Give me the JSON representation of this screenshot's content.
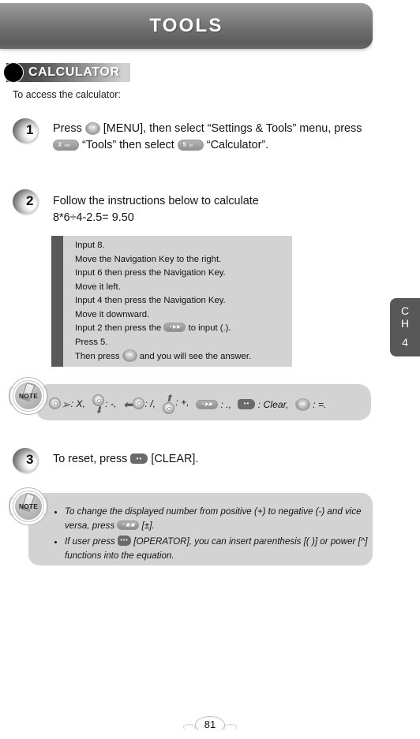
{
  "header": {
    "title": "TOOLS"
  },
  "section": {
    "title": "CALCULATOR",
    "intro": "To access the calculator:"
  },
  "steps": [
    {
      "number": "1",
      "text_part1": "Press",
      "key1": {
        "name": "ok-key",
        "label": "OK"
      },
      "text_part2": "[MENU], then select “Settings & Tools” menu, press",
      "key2": {
        "name": "2-abc-key",
        "main": "2",
        "sub": "abc"
      },
      "text_part3": "“Tools” then select",
      "key3": {
        "name": "5-jkl-key",
        "main": "5",
        "sub": "jkl"
      },
      "text_part4": "“Calculator”."
    },
    {
      "number": "2",
      "text_line1": "Follow the instructions below to calculate",
      "text_line2": "8*6÷4-2.5= 9.50"
    },
    {
      "number": "3",
      "text_part1": "To reset, press",
      "key1": {
        "name": "clear-key",
        "dots": "••"
      },
      "text_part2": "[CLEAR]."
    }
  ],
  "instructions": {
    "lines": [
      {
        "text": "Input 8."
      },
      {
        "text": "Move the Navigation Key to the right."
      },
      {
        "text": "Input 6 then press the Navigation Key."
      },
      {
        "text": "Move it left."
      },
      {
        "text": "Input 4 then press the Navigation Key."
      },
      {
        "text": "Move it downward."
      },
      {
        "pre": "Input 2 then press the",
        "key": "dot-key",
        "post": "to input (.)."
      },
      {
        "text": "Press 5."
      },
      {
        "pre": "Then press",
        "key": "ok-key",
        "post": "and you will see the answer."
      }
    ]
  },
  "legend": {
    "badge": "NOTE",
    "items": [
      {
        "icon": "nav-key-right",
        "label": ": X,"
      },
      {
        "icon": "nav-key-down",
        "label": ": -,"
      },
      {
        "icon": "nav-key-left",
        "label": ": /,"
      },
      {
        "icon": "nav-key-up",
        "label": ": +,"
      },
      {
        "icon": "dot-key",
        "label": ": .,"
      },
      {
        "icon": "clear-key",
        "label": ": Clear,"
      },
      {
        "icon": "ok-key",
        "label": ": =."
      }
    ]
  },
  "bottom_note": {
    "badge": "NOTE",
    "bullets": [
      {
        "pre": "To change the displayed number from positive (+) to negative (-) and vice versa, press",
        "key": "plusminus-key",
        "post": "[±]."
      },
      {
        "pre": "If user press",
        "key": "operator-key",
        "post": "[OPERATOR], you can insert parenthesis [(  )] or power [^] functions into the equation."
      }
    ]
  },
  "chapter_tab": {
    "line1": "C",
    "line2": "H",
    "number": "4"
  },
  "footer": {
    "page_number": "81"
  },
  "colors": {
    "header_dark": "#5d5d5d",
    "header_light": "#9b9b9b",
    "panel_gray": "#d3d3d3",
    "bar_dark": "#595959",
    "tab_gray": "#585858"
  }
}
